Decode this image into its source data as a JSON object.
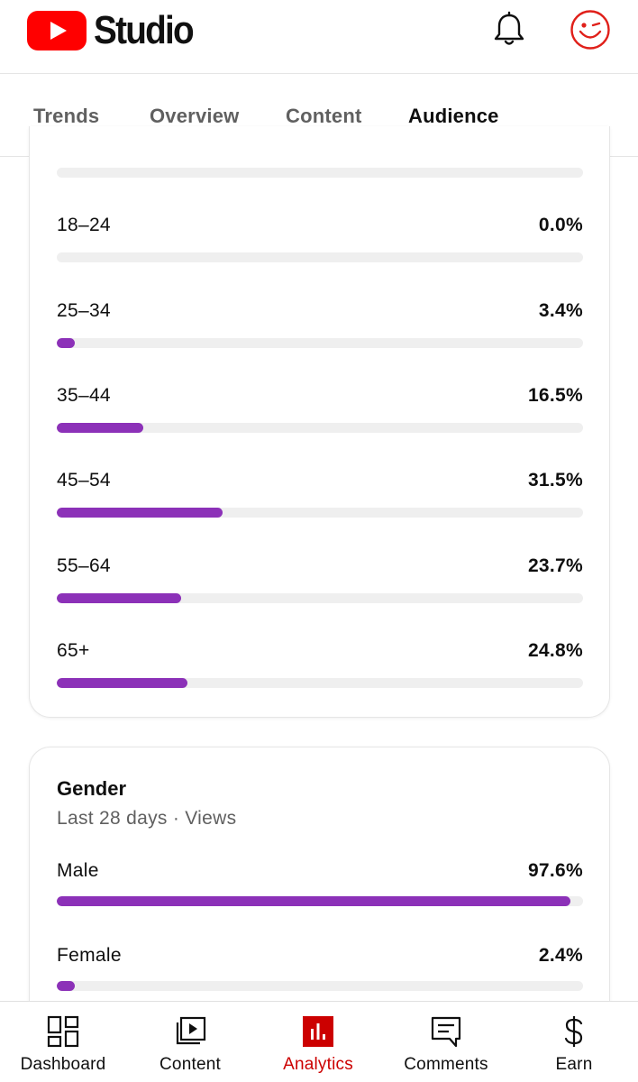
{
  "header": {
    "logo_text": "Studio",
    "brand_color": "#ff0000",
    "icons": [
      "bell-icon",
      "avatar-icon"
    ]
  },
  "tabs": [
    {
      "label": "Trends",
      "active": false
    },
    {
      "label": "Overview",
      "active": false
    },
    {
      "label": "Content",
      "active": false
    },
    {
      "label": "Audience",
      "active": true
    }
  ],
  "age_card": {
    "bar_color": "#8c31b8",
    "rows": [
      {
        "label": "18–24",
        "value": "0.0%",
        "percent": 0.0
      },
      {
        "label": "25–34",
        "value": "3.4%",
        "percent": 3.4
      },
      {
        "label": "35–44",
        "value": "16.5%",
        "percent": 16.5
      },
      {
        "label": "45–54",
        "value": "31.5%",
        "percent": 31.5
      },
      {
        "label": "55–64",
        "value": "23.7%",
        "percent": 23.7
      },
      {
        "label": "65+",
        "value": "24.8%",
        "percent": 24.8
      }
    ]
  },
  "gender_card": {
    "title": "Gender",
    "subtitle": "Last 28 days · Views",
    "rows": [
      {
        "label": "Male",
        "value": "97.6%",
        "percent": 97.6
      },
      {
        "label": "Female",
        "value": "2.4%",
        "percent": 2.4
      }
    ]
  },
  "bottom_nav": {
    "active_color": "#cc0000",
    "items": [
      {
        "label": "Dashboard",
        "icon": "dashboard-icon",
        "active": false
      },
      {
        "label": "Content",
        "icon": "content-icon",
        "active": false
      },
      {
        "label": "Analytics",
        "icon": "analytics-icon",
        "active": true
      },
      {
        "label": "Comments",
        "icon": "comments-icon",
        "active": false
      },
      {
        "label": "Earn",
        "icon": "earn-icon",
        "active": false
      }
    ]
  }
}
